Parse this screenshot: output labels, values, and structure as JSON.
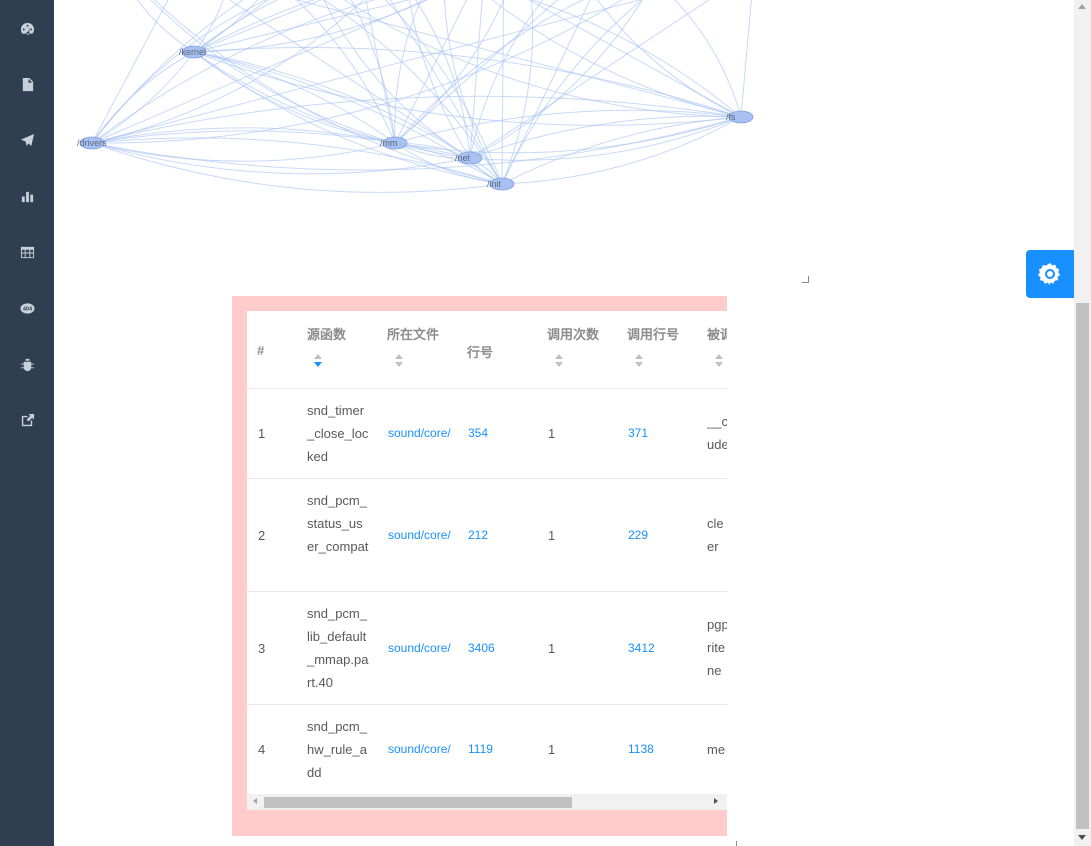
{
  "sidebar": {
    "items": [
      {
        "icon": "dashboard-icon"
      },
      {
        "icon": "document-icon"
      },
      {
        "icon": "send-icon"
      },
      {
        "icon": "bar-chart-icon"
      },
      {
        "icon": "table-icon"
      },
      {
        "icon": "404-icon"
      },
      {
        "icon": "bug-icon"
      },
      {
        "icon": "external-link-icon"
      }
    ]
  },
  "graph": {
    "nodes": [
      {
        "label": "/kernel"
      },
      {
        "label": "/drivers"
      },
      {
        "label": "/mm"
      },
      {
        "label": "/net"
      },
      {
        "label": "/init"
      },
      {
        "label": "/fs"
      }
    ],
    "edge_color": "#aac4f5",
    "node_color": "#a9c1f0"
  },
  "settings_button": {
    "icon": "gear-icon",
    "color": "#1890ff"
  },
  "table": {
    "headers": {
      "index": "#",
      "source_func": "源函数",
      "file": "所在文件",
      "line": "行号",
      "call_count": "调用次数",
      "call_line": "调用行号",
      "callee": "被调函"
    },
    "rows": [
      {
        "index": "1",
        "source_func": "snd_timer_close_locked",
        "file": "sound/core/",
        "line": "354",
        "call_count": "1",
        "call_line": "371",
        "callee": "__c ude"
      },
      {
        "index": "2",
        "source_func": "snd_pcm_status_user_compat",
        "file": "sound/core/",
        "line": "212",
        "call_count": "1",
        "call_line": "229",
        "callee": "cle er"
      },
      {
        "index": "3",
        "source_func": "snd_pcm_lib_default_mmap.part.40",
        "file": "sound/core/",
        "line": "3406",
        "call_count": "1",
        "call_line": "3412",
        "callee": "pgp rite ne"
      },
      {
        "index": "4",
        "source_func": "snd_pcm_hw_rule_add",
        "file": "sound/core/",
        "line": "1119",
        "call_count": "1",
        "call_line": "1138",
        "callee": "me"
      }
    ],
    "frame_color": "#ffcccb",
    "link_color": "#1890ff"
  }
}
